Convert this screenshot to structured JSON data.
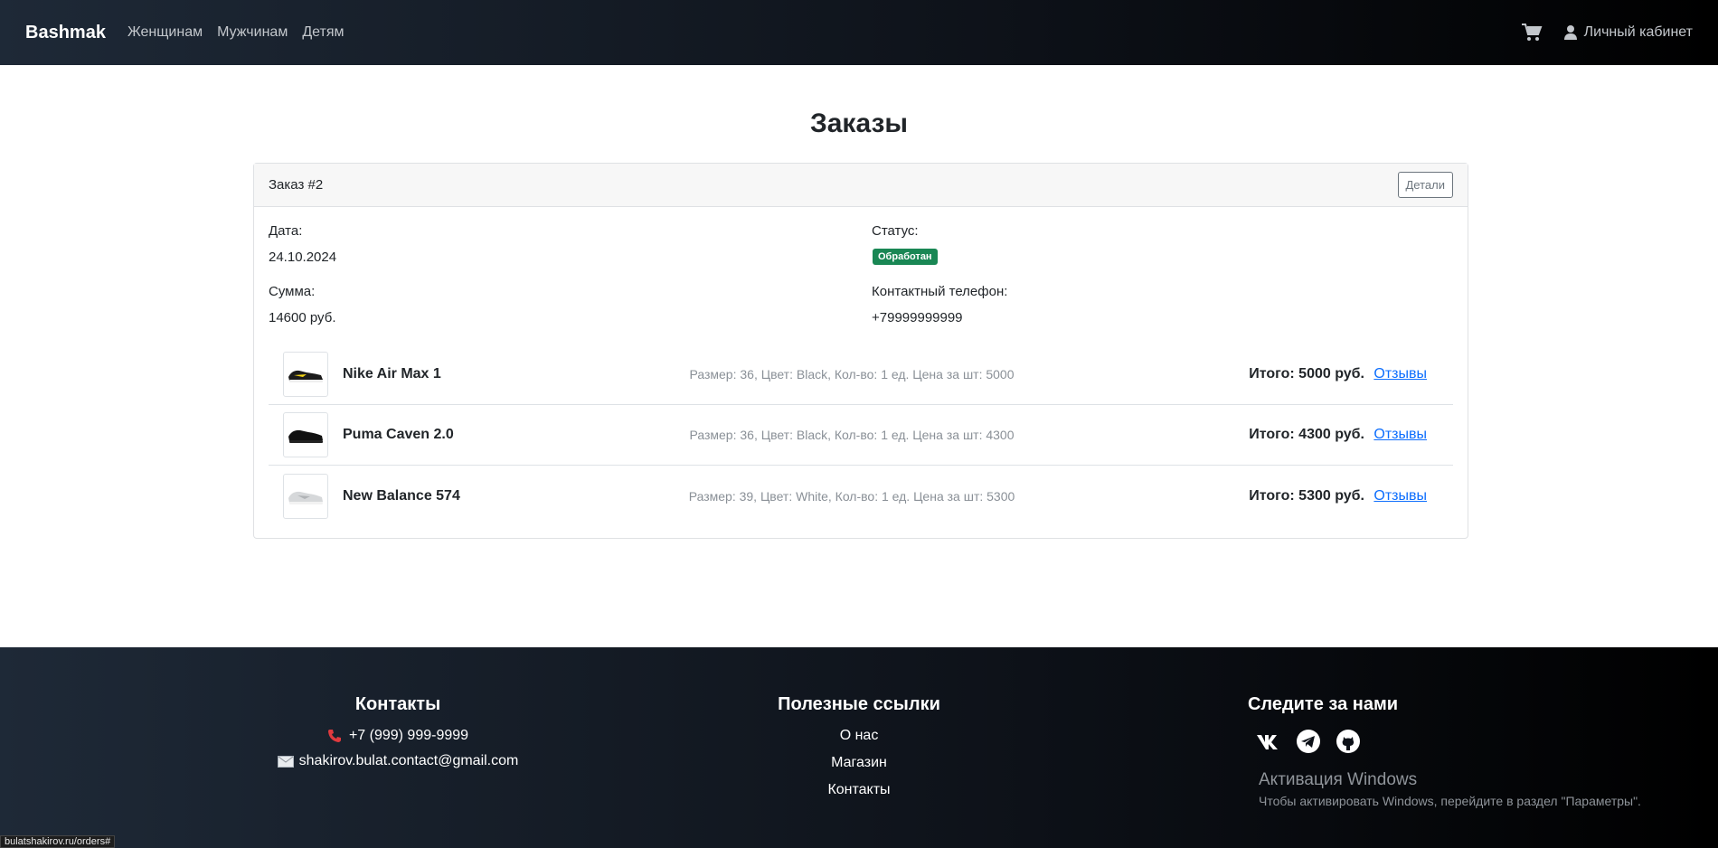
{
  "nav": {
    "brand": "Bashmak",
    "links": [
      "Женщинам",
      "Мужчинам",
      "Детям"
    ],
    "account": "Личный кабинет"
  },
  "page": {
    "title": "Заказы"
  },
  "order": {
    "header": "Заказ #2",
    "details_button": "Детали",
    "date_label": "Дата:",
    "date": "24.10.2024",
    "status_label": "Статус:",
    "status": "Обработан",
    "sum_label": "Сумма:",
    "sum": "14600 руб.",
    "phone_label": "Контактный телефон:",
    "phone": "+79999999999",
    "items": [
      {
        "name": "Nike Air Max 1",
        "desc": "Размер: 36, Цвет: Black, Кол-во: 1 ед. Цена за шт: 5000",
        "total": "Итого: 5000 руб.",
        "link": "Отзывы"
      },
      {
        "name": "Puma Caven 2.0",
        "desc": "Размер: 36, Цвет: Black, Кол-во: 1 ед. Цена за шт: 4300",
        "total": "Итого: 4300 руб.",
        "link": "Отзывы"
      },
      {
        "name": "New Balance 574",
        "desc": "Размер: 39, Цвет: White, Кол-во: 1 ед. Цена за шт: 5300",
        "total": "Итого: 5300 руб.",
        "link": "Отзывы"
      }
    ]
  },
  "footer": {
    "contacts_title": "Контакты",
    "phone": "+7 (999) 999-9999",
    "email": "shakirov.bulat.contact@gmail.com",
    "links_title": "Полезные ссылки",
    "links": [
      "О нас",
      "Магазин",
      "Контакты"
    ],
    "follow_title": "Следите за нами"
  },
  "overlay": {
    "windows_title": "Активация Windows",
    "windows_text": "Чтобы активировать Windows, перейдите в раздел \"Параметры\".",
    "status_url": "bulatshakirov.ru/orders#"
  },
  "colors": {
    "status_badge": "#198754",
    "link": "#0d6efd"
  },
  "icons": [
    "cart-icon",
    "user-icon",
    "phone-icon",
    "mail-icon",
    "vk-icon",
    "telegram-icon",
    "github-icon"
  ]
}
